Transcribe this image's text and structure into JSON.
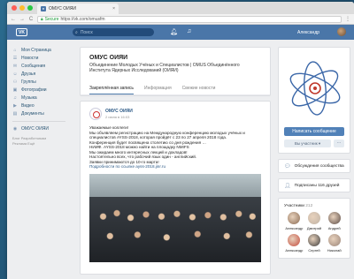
{
  "browser": {
    "tab_title": "ОМУС ОИЯИ",
    "tab_close": "×",
    "secure_label": "Secure",
    "url": "https://vk.com/omusfm",
    "back": "←",
    "forward": "→",
    "reload": "C",
    "menu": "⋮"
  },
  "header": {
    "logo": "VK",
    "search_placeholder": "Поиск",
    "user_name": "Александр"
  },
  "sidebar": {
    "items": [
      {
        "icon": "home-icon",
        "label": "Моя Страница"
      },
      {
        "icon": "news-icon",
        "label": "Новости"
      },
      {
        "icon": "messages-icon",
        "label": "Сообщения"
      },
      {
        "icon": "friends-icon",
        "label": "Друзья"
      },
      {
        "icon": "groups-icon",
        "label": "Группы"
      },
      {
        "icon": "photos-icon",
        "label": "Фотографии"
      },
      {
        "icon": "music-icon",
        "label": "Музыка"
      },
      {
        "icon": "videos-icon",
        "label": "Видео"
      },
      {
        "icon": "docs-icon",
        "label": "Документы"
      }
    ],
    "extra": {
      "icon": "community-icon",
      "label": "ОМУС ОИЯИ"
    },
    "footer_line1": "Блог   Разработчикам",
    "footer_line2": "Реклама   Ещё"
  },
  "group": {
    "name": "ОМУС ОИЯИ",
    "description_lines": [
      "Объединение Молодых Учёных и Специалистов | OMUS Объединённого",
      "Института Ядерных Исследований (ОИЯИ)"
    ],
    "tabs": [
      {
        "label": "Закреплённая запись",
        "active": true
      },
      {
        "label": "Информация",
        "active": false
      },
      {
        "label": "Свежие новости",
        "active": false
      }
    ]
  },
  "post": {
    "author": "ОМУС ОИЯИ",
    "date": "2 июня в 16:03",
    "lines": [
      "Уважаемые коллеги!",
      "Мы объявляем регистрацию на Международную конференцию молодых учёных и",
      "специалистов AYSS-2018, которая пройдёт с 23 по 27 апреля 2018 года.",
      "Конференция будет посвящена столетию со дня рождения … ",
      "НИИФ. AYSS-2018 можно найти на площадку NMIFS",
      "Мы ожидаем много интересных лекций и докладов!",
      "Настоятельно всех, что рабочий язык один - английский.",
      "Заявки принимаются до 10-го марта!",
      "Подробности по ссылке ayss-2018.jinr.ru"
    ]
  },
  "right": {
    "primary_button": "Написать сообщение",
    "secondary_button": "Вы участник ▾",
    "more_button": "···",
    "discussions": "Обсуждения сообщества",
    "subscribed": "Подписаны 116 друзей",
    "members_label": "Участники",
    "members_count": "212",
    "members": [
      {
        "name": "Александр",
        "color": "#8a6a52"
      },
      {
        "name": "Дмитрий",
        "color": "#c0b3a5"
      },
      {
        "name": "Андрей",
        "color": "#5a4a44"
      },
      {
        "name": "Александр",
        "color": "#c44a3c"
      },
      {
        "name": "Сергей",
        "color": "#3a3a3a"
      },
      {
        "name": "Николай",
        "color": "#9a8478"
      }
    ]
  },
  "colors": {
    "accent": "#4a76a8",
    "button": "#5181b8",
    "link": "#2a5885",
    "page_bg": "#edeef0"
  }
}
